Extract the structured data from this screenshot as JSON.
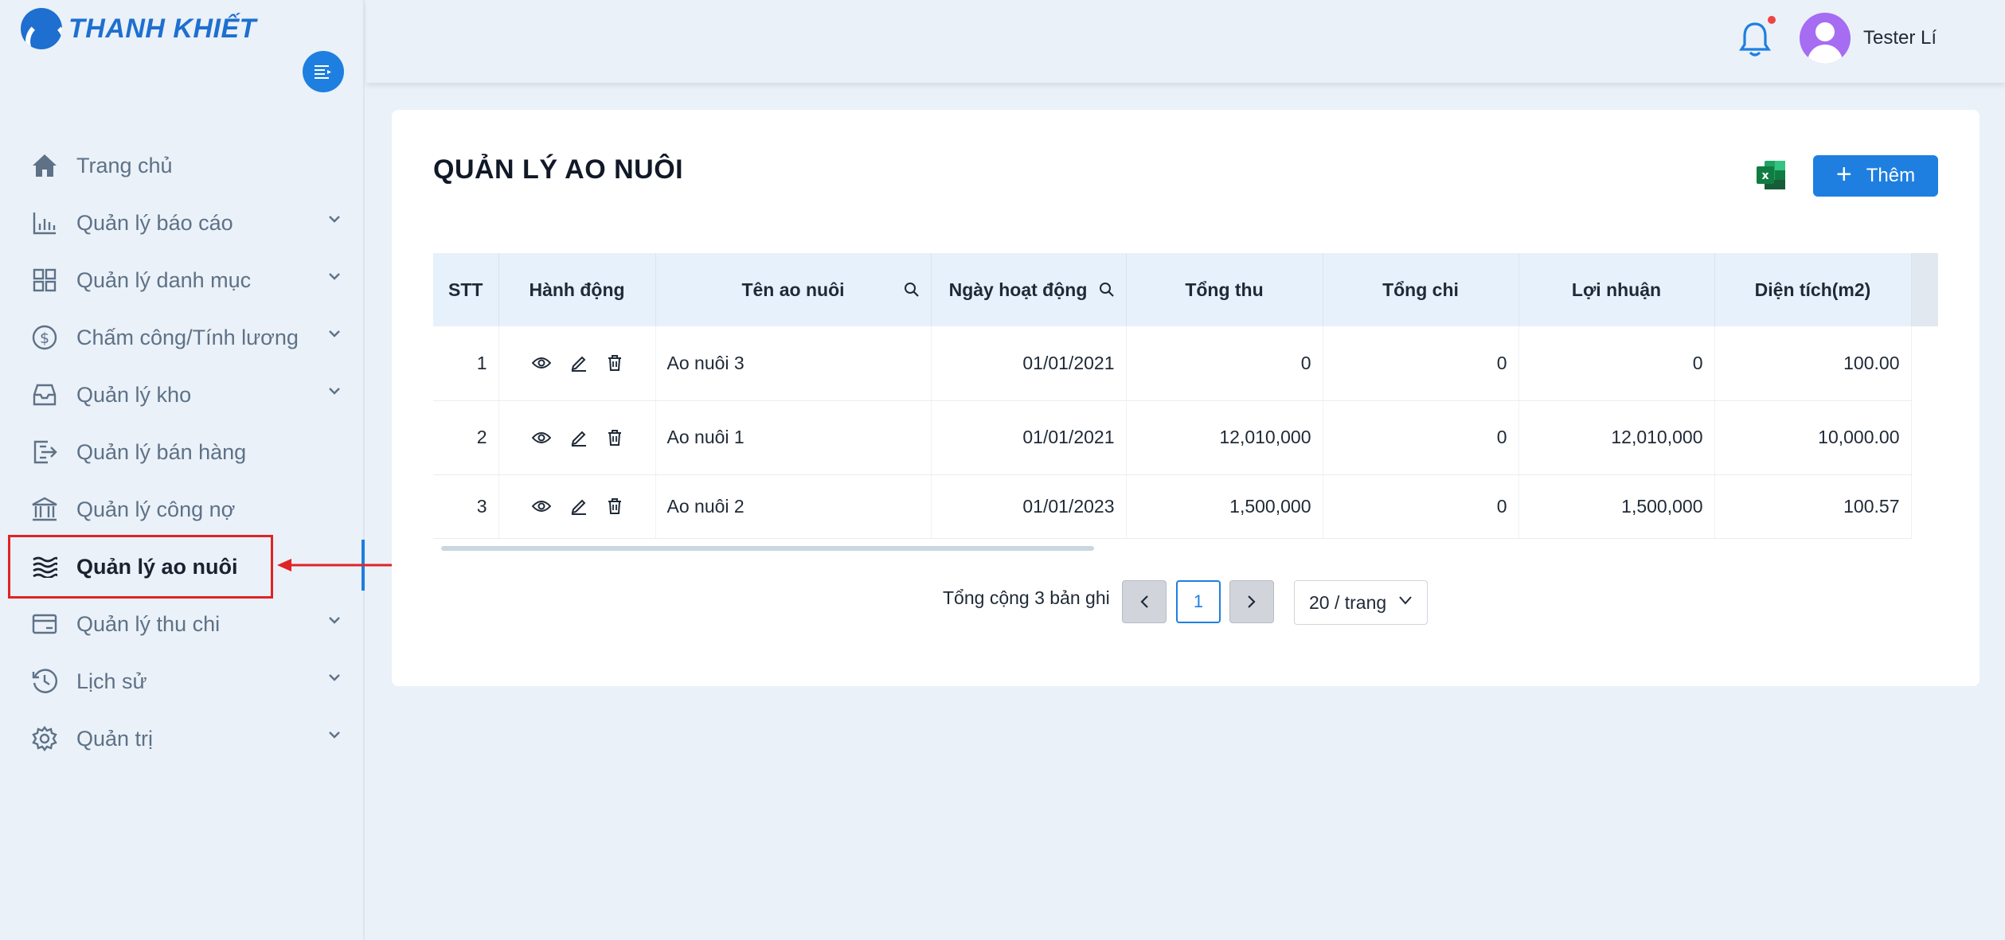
{
  "brand": {
    "name": "THANH KHIẾT"
  },
  "sidebar": {
    "items": [
      {
        "label": "Trang chủ",
        "icon": "home-icon",
        "has_children": false
      },
      {
        "label": "Quản lý báo cáo",
        "icon": "bar-chart-icon",
        "has_children": true
      },
      {
        "label": "Quản lý danh mục",
        "icon": "grid-icon",
        "has_children": true
      },
      {
        "label": "Chấm công/Tính lương",
        "icon": "dollar-circle-icon",
        "has_children": true
      },
      {
        "label": "Quản lý kho",
        "icon": "inbox-icon",
        "has_children": true
      },
      {
        "label": "Quản lý bán hàng",
        "icon": "export-icon",
        "has_children": false
      },
      {
        "label": "Quản lý công nợ",
        "icon": "bank-icon",
        "has_children": false
      },
      {
        "label": "Quản lý ao nuôi",
        "icon": "waves-icon",
        "has_children": false,
        "active": true
      },
      {
        "label": "Quản lý thu chi",
        "icon": "credit-card-icon",
        "has_children": true
      },
      {
        "label": "Lịch sử",
        "icon": "clock-icon",
        "has_children": true
      },
      {
        "label": "Quản trị",
        "icon": "gear-icon",
        "has_children": true
      }
    ]
  },
  "header": {
    "username": "Tester Lí",
    "has_notification": true
  },
  "page": {
    "title": "QUẢN LÝ AO NUÔI",
    "add_label": "Thêm"
  },
  "table": {
    "columns": [
      "STT",
      "Hành động",
      "Tên ao nuôi",
      "Ngày hoạt động",
      "Tổng thu",
      "Tổng chi",
      "Lợi nhuận",
      "Diện tích(m2)"
    ],
    "rows": [
      {
        "stt": "1",
        "name": "Ao nuôi 3",
        "date": "01/01/2021",
        "revenue": "0",
        "expense": "0",
        "profit": "0",
        "area": "100.00"
      },
      {
        "stt": "2",
        "name": "Ao nuôi 1",
        "date": "01/01/2021",
        "revenue": "12,010,000",
        "expense": "0",
        "profit": "12,010,000",
        "area": "10,000.00"
      },
      {
        "stt": "3",
        "name": "Ao nuôi 2",
        "date": "01/01/2023",
        "revenue": "1,500,000",
        "expense": "0",
        "profit": "1,500,000",
        "area": "100.57"
      }
    ]
  },
  "pagination": {
    "total_text": "Tổng cộng 3 bản ghi",
    "current_page": "1",
    "page_size": "20 / trang"
  },
  "colors": {
    "accent": "#1e7fe0",
    "highlight": "#e02424",
    "excel": "#1d7a45"
  }
}
